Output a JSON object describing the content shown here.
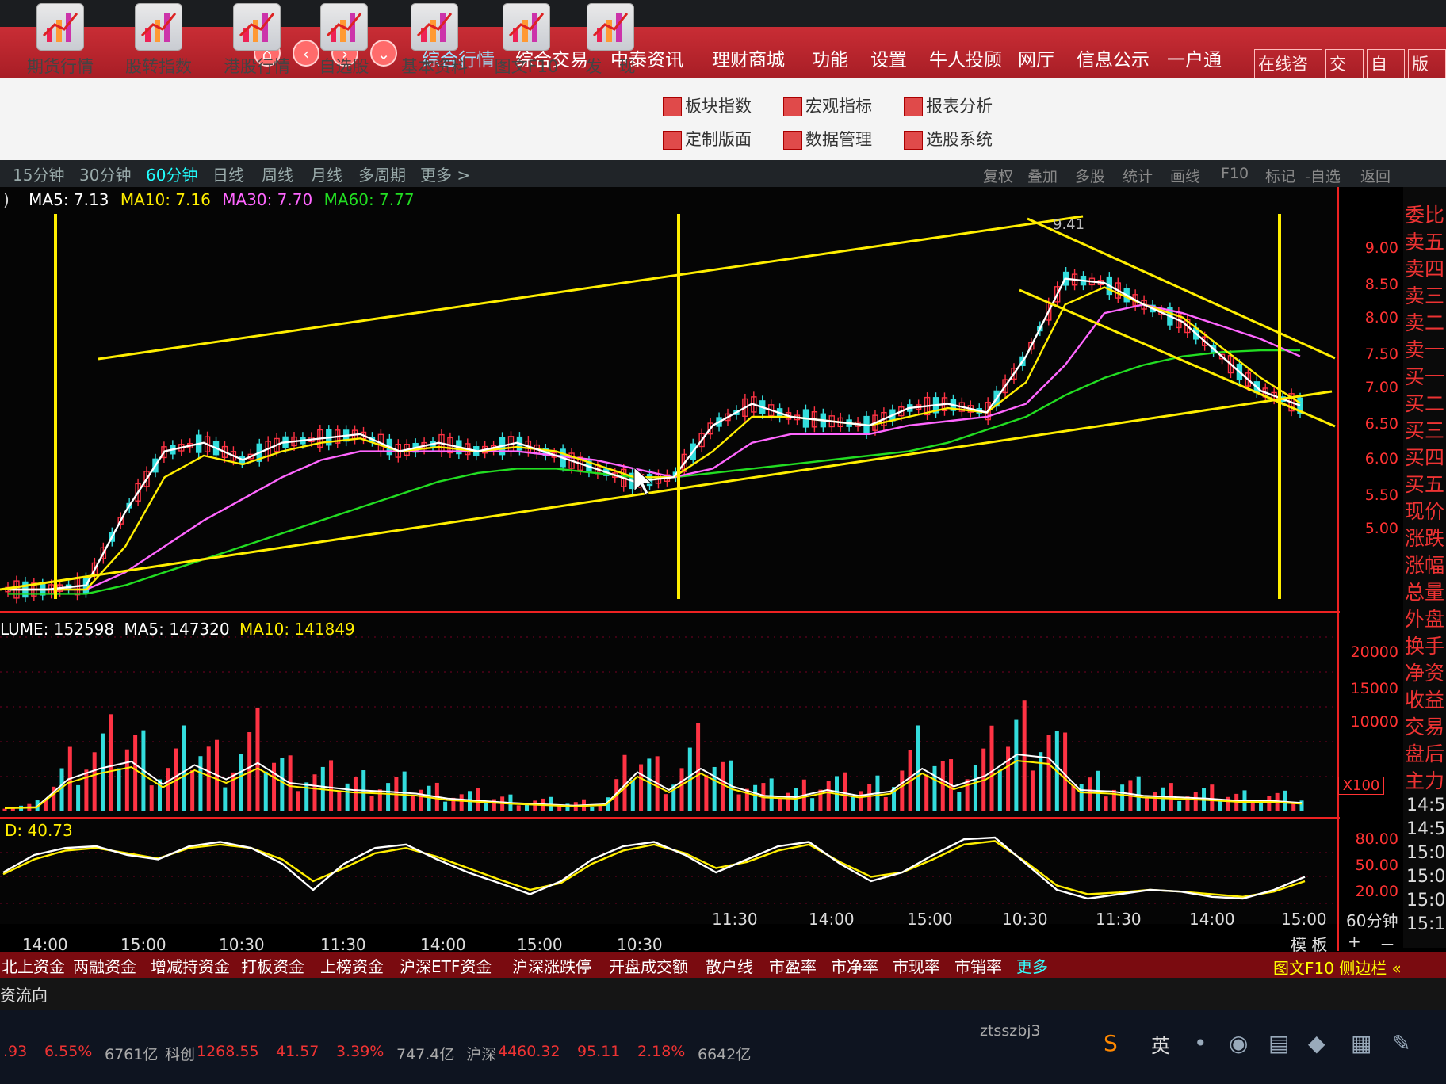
{
  "nav_buttons": [
    "home-icon",
    "back-icon",
    "forward-icon",
    "down-icon"
  ],
  "menu": [
    "综合行情",
    "综合交易",
    "中泰资讯",
    "理财商城",
    "功能",
    "设置",
    "牛人投顾",
    "网厅",
    "信息公示",
    "一户通"
  ],
  "right_tabs": [
    "在线咨询",
    "交易",
    "自选",
    "版面"
  ],
  "tools": [
    {
      "label": "期货行情",
      "icon": "bar-chart-icon"
    },
    {
      "label": "股转指数",
      "icon": "wave-chart-icon"
    },
    {
      "label": "港股行情",
      "icon": "bar-chart-icon"
    },
    {
      "label": "自选股",
      "icon": "magnifier-icon"
    },
    {
      "label": "基本资料",
      "icon": "key-icon"
    },
    {
      "label": "图文F10",
      "icon": "pen-icon"
    },
    {
      "label": "发　现",
      "icon": "line-chart-icon"
    }
  ],
  "small_tools": [
    {
      "label": "板块指数",
      "icon": "grid-icon"
    },
    {
      "label": "定制版面",
      "icon": "layout-icon"
    },
    {
      "label": "宏观指标",
      "icon": "stats-icon"
    },
    {
      "label": "数据管理",
      "icon": "data-icon"
    },
    {
      "label": "报表分析",
      "icon": "report-icon"
    },
    {
      "label": "选股系统",
      "icon": "filter-icon"
    }
  ],
  "periods": [
    "15分钟",
    "30分钟",
    "60分钟",
    "日线",
    "周线",
    "月线",
    "多周期",
    "更多 >"
  ],
  "active_period": "60分钟",
  "chart_tools": [
    "复权",
    "叠加",
    "多股",
    "统计",
    "画线",
    "F10",
    "标记",
    "-自选",
    "返回"
  ],
  "ma_legend": {
    "prefix": ")",
    "ma5": "MA5: 7.13",
    "ma10": "MA10: 7.16",
    "ma30": "MA30: 7.70",
    "ma60": "MA60: 7.77",
    "high_label": "9.41"
  },
  "vol_legend": {
    "label": "LUME: 152598",
    "ma5": "MA5: 147320",
    "ma10": "MA10: 141849"
  },
  "kdj_legend": "D: 40.73",
  "price_ticks": [
    "9.00",
    "8.50",
    "8.00",
    "7.50",
    "7.00",
    "6.50",
    "6.00",
    "5.50",
    "5.00"
  ],
  "vol_ticks": [
    "20000",
    "15000",
    "10000"
  ],
  "vol_unit": "X100",
  "kdj_ticks": [
    "80.00",
    "50.00",
    "20.00"
  ],
  "right_panel": [
    "委比",
    "卖五",
    "卖四",
    "卖三",
    "卖二",
    "卖一",
    "买一",
    "买二",
    "买三",
    "买四",
    "买五",
    "现价",
    "涨跌",
    "涨幅",
    "总量",
    "外盘",
    "换手",
    "净资",
    "收益",
    "交易",
    "盘后",
    "主力"
  ],
  "right_times": [
    "14:5",
    "14:5",
    "15:0",
    "15:0",
    "15:0",
    "15:1"
  ],
  "x_ticks": [
    "14:00",
    "15:00",
    "10:30",
    "11:30",
    "14:00",
    "15:00",
    "10:30",
    "11:30",
    "14:00",
    "15:00",
    "10:30",
    "11:30",
    "14:00",
    "15:00"
  ],
  "period_label": "60分钟",
  "template_label": "模 板",
  "zoom": [
    "+",
    "－"
  ],
  "bottom_tabs": [
    "北上资金",
    "两融资金",
    "增减持资金",
    "打板资金",
    "上榜资金",
    "沪深ETF资金",
    "沪深涨跌停",
    "开盘成交额",
    "散户线",
    "市盈率",
    "市净率",
    "市现率",
    "市销率",
    "更多"
  ],
  "side_link": "图文F10 侧边栏 «",
  "status_left": "资流向",
  "ticker": [
    {
      "text": ".93",
      "color": "#e33"
    },
    {
      "text": "6.55%",
      "color": "#e33"
    },
    {
      "text": "6761亿",
      "color": "#aaa"
    },
    {
      "text": "科创",
      "color": "#aaa"
    },
    {
      "text": "1268.55",
      "color": "#e33"
    },
    {
      "text": "41.57",
      "color": "#e33"
    },
    {
      "text": "3.39%",
      "color": "#e33"
    },
    {
      "text": "747.4亿",
      "color": "#aaa"
    },
    {
      "text": "沪深",
      "color": "#aaa"
    },
    {
      "text": "4460.32",
      "color": "#e33"
    },
    {
      "text": "95.11",
      "color": "#e33"
    },
    {
      "text": "2.18%",
      "color": "#e33"
    },
    {
      "text": "6642亿",
      "color": "#aaa"
    }
  ],
  "user": "ztsszbj3",
  "colors": {
    "ma5": "#ffffff",
    "ma10": "#ffee00",
    "ma30": "#ff66ff",
    "ma60": "#22dd22",
    "up": "#ff3344",
    "down": "#33dddd",
    "trend": "#ffee00"
  },
  "chart_data": {
    "type": "candlestick",
    "price_axis": [
      5.0,
      9.0
    ],
    "ma5": [
      5.0,
      5.0,
      5.05,
      5.9,
      6.6,
      6.7,
      6.5,
      6.7,
      6.75,
      6.8,
      6.6,
      6.7,
      6.6,
      6.7,
      6.55,
      6.4,
      6.25,
      6.3,
      6.9,
      7.15,
      7.0,
      6.95,
      6.9,
      7.1,
      7.15,
      7.05,
      7.7,
      8.6,
      8.55,
      8.3,
      8.1,
      7.7,
      7.3,
      7.13
    ],
    "ma10": [
      5.0,
      5.0,
      5.0,
      5.5,
      6.3,
      6.55,
      6.45,
      6.6,
      6.7,
      6.75,
      6.6,
      6.65,
      6.6,
      6.65,
      6.6,
      6.45,
      6.3,
      6.3,
      6.6,
      7.0,
      7.0,
      6.95,
      6.9,
      7.0,
      7.1,
      7.05,
      7.4,
      8.3,
      8.5,
      8.3,
      8.15,
      7.8,
      7.45,
      7.16
    ],
    "ma30": [
      5.0,
      5.0,
      5.0,
      5.2,
      5.5,
      5.8,
      6.05,
      6.3,
      6.5,
      6.6,
      6.6,
      6.6,
      6.6,
      6.6,
      6.55,
      6.5,
      6.4,
      6.3,
      6.4,
      6.7,
      6.8,
      6.8,
      6.8,
      6.9,
      6.95,
      7.0,
      7.15,
      7.6,
      8.2,
      8.3,
      8.2,
      8.05,
      7.9,
      7.7
    ],
    "ma60": [
      4.95,
      4.95,
      4.95,
      5.05,
      5.2,
      5.35,
      5.5,
      5.65,
      5.8,
      5.95,
      6.1,
      6.25,
      6.35,
      6.4,
      6.4,
      6.35,
      6.3,
      6.3,
      6.35,
      6.4,
      6.45,
      6.5,
      6.55,
      6.6,
      6.7,
      6.85,
      7.0,
      7.25,
      7.45,
      7.6,
      7.7,
      7.75,
      7.77,
      7.77
    ],
    "kdj_k": [
      50,
      70,
      78,
      80,
      70,
      65,
      80,
      85,
      78,
      60,
      30,
      60,
      78,
      82,
      65,
      50,
      38,
      25,
      40,
      65,
      80,
      85,
      70,
      50,
      65,
      80,
      85,
      60,
      40,
      50,
      70,
      88,
      90,
      60,
      30,
      20,
      25,
      30,
      28,
      22,
      20,
      30,
      45
    ],
    "kdj_d": [
      48,
      65,
      75,
      78,
      72,
      66,
      78,
      82,
      78,
      65,
      40,
      55,
      72,
      78,
      68,
      55,
      42,
      30,
      38,
      60,
      75,
      82,
      72,
      55,
      62,
      75,
      82,
      62,
      45,
      50,
      65,
      82,
      86,
      62,
      35,
      25,
      27,
      30,
      28,
      25,
      22,
      28,
      40
    ],
    "volume": [
      5,
      6,
      45,
      60,
      70,
      38,
      65,
      45,
      68,
      40,
      35,
      30,
      28,
      25,
      18,
      15,
      12,
      10,
      8,
      10,
      55,
      30,
      60,
      35,
      22,
      20,
      30,
      22,
      28,
      60,
      35,
      50,
      80,
      75,
      30,
      28,
      22,
      20,
      18,
      15,
      15,
      12
    ]
  }
}
